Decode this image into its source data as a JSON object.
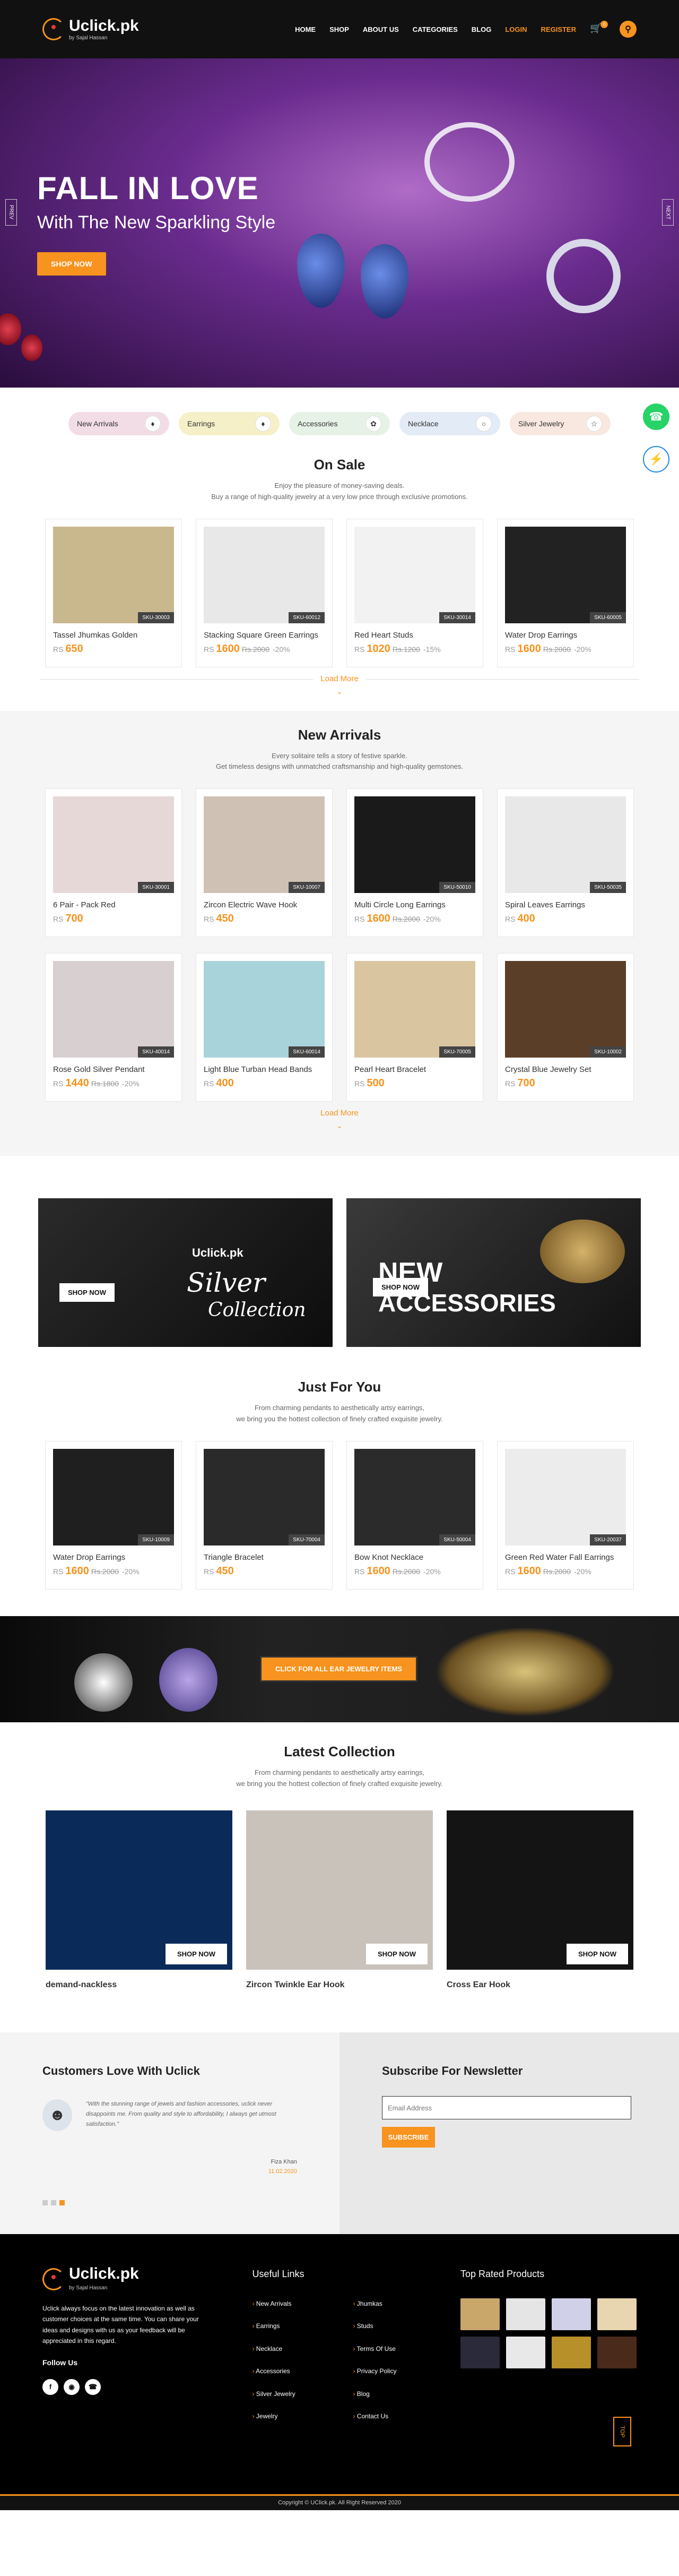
{
  "header": {
    "logo_text": "Uclick.pk",
    "logo_sub": "by Sajal Hassan",
    "nav": [
      "HOME",
      "SHOP",
      "ABOUT US",
      "CATEGORIES",
      "BLOG"
    ],
    "login": "LOGIN",
    "register": "REGISTER",
    "cart_count": "0"
  },
  "hero": {
    "title": "FALL IN LOVE",
    "subtitle": "With The New Sparkling Style",
    "button": "SHOP NOW",
    "prev": "PREV",
    "next": "NEXT"
  },
  "categories": [
    {
      "label": "New Arrivals",
      "color": "#f2dde6"
    },
    {
      "label": "Earrings",
      "color": "#f5f0c8"
    },
    {
      "label": "Accessories",
      "color": "#e6f2e6"
    },
    {
      "label": "Necklace",
      "color": "#e2ebf6"
    },
    {
      "label": "Silver Jewelry",
      "color": "#f8e8e0"
    }
  ],
  "on_sale": {
    "title": "On Sale",
    "desc1": "Enjoy the pleasure of money-saving deals.",
    "desc2": "Buy a range of high-quality jewelry at a very low price through exclusive promotions.",
    "items": [
      {
        "name": "Tassel Jhumkas Golden",
        "sku": "SKU-30003",
        "price": "650",
        "old": "",
        "off": "",
        "bg": "#c9b88e"
      },
      {
        "name": "Stacking Square Green Earrings",
        "sku": "SKU-60012",
        "price": "1600",
        "old": "Rs.2000",
        "off": "-20%",
        "bg": "#e8e8e8"
      },
      {
        "name": "Red Heart Studs",
        "sku": "SKU-30014",
        "price": "1020",
        "old": "Rs.1200",
        "off": "-15%",
        "bg": "#f2f2f2"
      },
      {
        "name": "Water Drop Earrings",
        "sku": "SKU-60005",
        "price": "1600",
        "old": "Rs.2000",
        "off": "-20%",
        "bg": "#222"
      }
    ],
    "load_more": "Load More"
  },
  "new_arrivals": {
    "title": "New Arrivals",
    "desc1": "Every solitaire tells a story of festive sparkle.",
    "desc2": "Get timeless designs with unmatched craftsmanship and high-quality gemstones.",
    "items": [
      {
        "name": "6 Pair - Pack Red",
        "sku": "SKU-30001",
        "price": "700",
        "old": "",
        "off": "",
        "bg": "#e7d8d8"
      },
      {
        "name": "Zircon Electric Wave Hook",
        "sku": "SKU-10007",
        "price": "450",
        "old": "",
        "off": "",
        "bg": "#cfc2b5"
      },
      {
        "name": "Multi Circle Long Earrings",
        "sku": "SKU-50010",
        "price": "1600",
        "old": "Rs.2000",
        "off": "-20%",
        "bg": "#1a1a1a"
      },
      {
        "name": "Spiral Leaves Earrings",
        "sku": "SKU-50035",
        "price": "400",
        "old": "",
        "off": "",
        "bg": "#e8e8e8"
      },
      {
        "name": "Rose Gold Silver Pendant",
        "sku": "SKU-40014",
        "price": "1440",
        "old": "Rs.1800",
        "off": "-20%",
        "bg": "#d8cfd0"
      },
      {
        "name": "Light Blue Turban Head Bands",
        "sku": "SKU-60014",
        "price": "400",
        "old": "",
        "off": "",
        "bg": "#a9d3da"
      },
      {
        "name": "Pearl Heart Bracelet",
        "sku": "SKU-70005",
        "price": "500",
        "old": "",
        "off": "",
        "bg": "#d9c6a0"
      },
      {
        "name": "Crystal Blue Jewelry Set",
        "sku": "SKU-10002",
        "price": "700",
        "old": "",
        "off": "",
        "bg": "#5a3e28"
      }
    ],
    "load_more": "Load More"
  },
  "banners": {
    "left_brand": "Uclick.pk",
    "left_title": "Silver",
    "left_sub": "Collection",
    "left_button": "SHOP NOW",
    "right_title1": "NEW",
    "right_title2": "ACCESSORIES",
    "right_button": "SHOP NOW"
  },
  "just_for_you": {
    "title": "Just For You",
    "desc1": "From charming pendants to aesthetically artsy earrings,",
    "desc2": "we bring you the hottest collection of finely crafted exquisite jewelry.",
    "items": [
      {
        "name": "Water Drop Earrings",
        "sku": "SKU-10009",
        "price": "1600",
        "old": "Rs.2000",
        "off": "-20%",
        "bg": "#1f1f1f"
      },
      {
        "name": "Triangle Bracelet",
        "sku": "SKU-70004",
        "price": "450",
        "old": "",
        "off": "",
        "bg": "#2a2a2a"
      },
      {
        "name": "Bow Knot Necklace",
        "sku": "SKU-50004",
        "price": "1600",
        "old": "Rs.2000",
        "off": "-20%",
        "bg": "#2b2b2b"
      },
      {
        "name": "Green Red Water Fall Earrings",
        "sku": "SKU-20037",
        "price": "1600",
        "old": "Rs.2000",
        "off": "-20%",
        "bg": "#ececec"
      }
    ]
  },
  "promo": {
    "button": "CLICK FOR ALL EAR JEWELRY ITEMS"
  },
  "latest": {
    "title": "Latest Collection",
    "desc1": "From charming pendants to aesthetically artsy earrings,",
    "desc2": "we bring you the hottest collection of finely crafted exquisite jewelry.",
    "items": [
      {
        "name": "demand-nackless",
        "button": "SHOP NOW",
        "bg": "#0a2a5a"
      },
      {
        "name": "Zircon Twinkle Ear Hook",
        "button": "SHOP NOW",
        "bg": "#c9c2bb"
      },
      {
        "name": "Cross Ear Hook",
        "button": "SHOP NOW",
        "bg": "#141414"
      }
    ]
  },
  "testimonial": {
    "title": "Customers Love With Uclick",
    "text": "\"With the stunning range of jewels and fashion accessories, uclick never disappoints me. From quality and style to affordability, I always get utmost satisfaction.\"",
    "author": "Fiza Khan",
    "date": "11.02.2020"
  },
  "newsletter": {
    "title": "Subscribe For Newsletter",
    "placeholder": "Email Address",
    "button": "SUBSCRIBE"
  },
  "footer": {
    "about": "Uclick always focus on the latest innovation as well as customer choices at the same time. You can share your ideas and designs with us as your feedback will be appreciated in this regard.",
    "follow": "Follow Us",
    "useful_title": "Useful Links",
    "links": [
      "New Arrivals",
      "Jhumkas",
      "Earrings",
      "Studs",
      "Necklace",
      "Terms Of Use",
      "Accessories",
      "Privacy Policy",
      "Silver Jewelry",
      "Blog",
      "Jewelry",
      "Contact Us"
    ],
    "top_title": "Top Rated Products",
    "top_button": "TOP",
    "copyright": "Copyright © UClick.pk. All Right Reserved 2020"
  }
}
